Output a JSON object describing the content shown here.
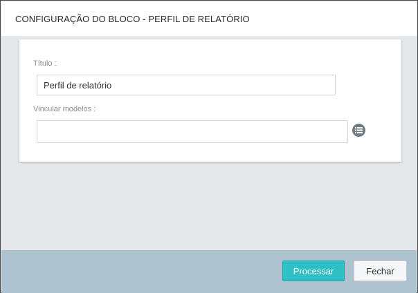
{
  "dialog": {
    "title": "CONFIGURAÇÃO DO BLOCO - PERFIL DE RELATÓRIO"
  },
  "form": {
    "title_label": "Título :",
    "title_value": "Perfil de relatório",
    "models_label": "Vincular modelos :",
    "models_value": "",
    "models_button_icon": "list-icon"
  },
  "footer": {
    "process_label": "Processar",
    "close_label": "Fechar"
  },
  "colors": {
    "accent": "#2fc0c6",
    "footer_bg": "#aec3cf",
    "body_bg": "#e4e8ea"
  }
}
